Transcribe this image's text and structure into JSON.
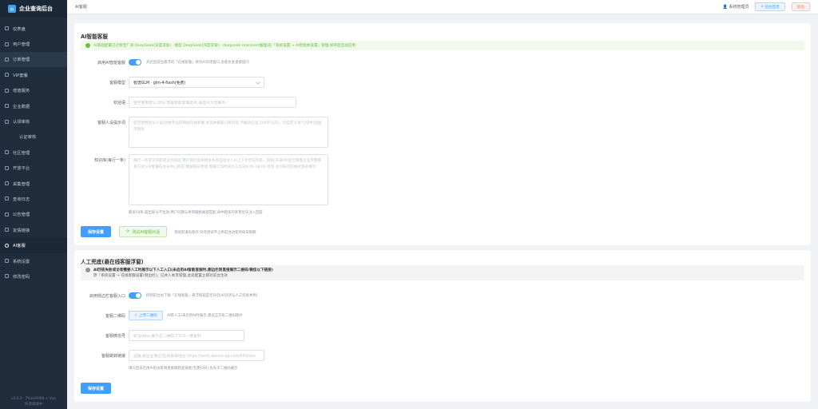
{
  "sidebar": {
    "title": "企业查询后台",
    "items": [
      {
        "label": "仪表盘",
        "icon": "dashboard-icon"
      },
      {
        "label": "用户管理",
        "icon": "user-icon"
      },
      {
        "label": "订单管理",
        "icon": "order-icon"
      },
      {
        "label": "VIP套餐",
        "icon": "vip-icon"
      },
      {
        "label": "增值服务",
        "icon": "service-icon"
      },
      {
        "label": "企业数据",
        "icon": "data-icon"
      },
      {
        "label": "认领审核",
        "icon": "audit-icon"
      },
      {
        "label": "认证审核",
        "icon": ""
      },
      {
        "label": "社区管理",
        "icon": "community-icon"
      },
      {
        "label": "开放平台",
        "icon": "platform-icon"
      },
      {
        "label": "采集管理",
        "icon": "collect-icon"
      },
      {
        "label": "查询日志",
        "icon": "log-icon"
      },
      {
        "label": "公告管理",
        "icon": "notice-icon"
      },
      {
        "label": "友情链接",
        "icon": "link-icon"
      },
      {
        "label": "AI客服",
        "icon": "headset-icon"
      },
      {
        "label": "系统设置",
        "icon": "settings-icon"
      },
      {
        "label": "修改密码",
        "icon": "lock-icon"
      }
    ],
    "footer_line1": "v2.0.0 · ThinkPHP8 + Vue",
    "footer_line2": "对话调试中"
  },
  "header": {
    "breadcrumb": "AI客服",
    "admin": "系统管理员",
    "home_btn": "前往首页",
    "logout_btn": "退出"
  },
  "ai": {
    "title": "AI智能客服",
    "banner": "AI基础配置已迁移至厂商 DeepSeek(深度求索) · 模型 DeepSeek(深度求索) · deepseek-reasoner(推理)在「系统设置 → AI智能体设置」管理,保存后自动应用",
    "enable_label": "启用AI智能客服",
    "enable_hint": "开启后前台悬浮的「在线客服」将为AI对话窗口,访客也会直接提问",
    "model_label": "客服模型",
    "model_value": "智谱GLM · glm-4-flash(免费)",
    "welcome_label": "欢迎语",
    "welcome_placeholder": "留空使用默认:您好,我是智能客服助手,很高兴为您服务~",
    "persona_label": "客服人设提示词",
    "persona_placeholder": "留空使用默认人设(热情专业的网站在线客服,优先依据知识库作答,不编造信息,200字以内)。可自定义语气/话术/回复范围等",
    "kb_label": "知识库(每行一条)",
    "kb_placeholder": "每行一条常见问题或业务知识,用户提问会将相关条目自动注入AI上下文优先作答。例如:开通VIP后可查看企业完整联系方式;VIP套餐在会员中心购买;数据每日更新;客服工作时间为工作日9:00-18:00 等等,也可按问答格式逐条填写",
    "kb_hint": "最多50条,超出部分不生效;用户问题与条目越相关越匹配,命中越多的条目优先注入回答",
    "save_btn": "保存设置",
    "test_btn": "测试AI客服对话",
    "test_hint": "测试前请先保存;对话测试不占用前台访客的每日限额"
  },
  "human": {
    "title": "人工兜底(悬在线客服浮窗)",
    "banner_line1": "AI回答失败或访客需要人工时展示以下人工入口(未启用AI智能客服时,侧边栏则直接展示二维码/微信以下链接)",
    "banner_line2": "原「系统设置 → 在线客服设置(侧边栏)」已并入本页管理,此处配置立即对前台生效",
    "entry_label": "启用侧边栏客服入口",
    "entry_hint": "控制前台右下角「在线客服」悬浮按钮是否开启(AI对话与人工兜底共用)",
    "qrcode_label": "客服二维码",
    "upload_btn": "上传二维码",
    "qrcode_hint": "AI转人工/未启用AI时展示,建议正方形二维码图片",
    "wechat_label": "客服微信号",
    "wechat_placeholder": "如:gsdax,展示在二维码下方可一键复制",
    "link_label": "客服跳转链接",
    "link_placeholder": "选填,如企业微信/在线表单地址 https://work.weixin.qq.com/kfid/xxx",
    "link_hint": "填写后未启用AI的访客将直接跳转此链接(无需扫码),优先于二维码展示",
    "save_btn": "保存设置"
  },
  "colors": {
    "primary": "#409eff",
    "success": "#67c23a",
    "sidebar": "#1f2d3d",
    "danger": "#f56c6c"
  }
}
